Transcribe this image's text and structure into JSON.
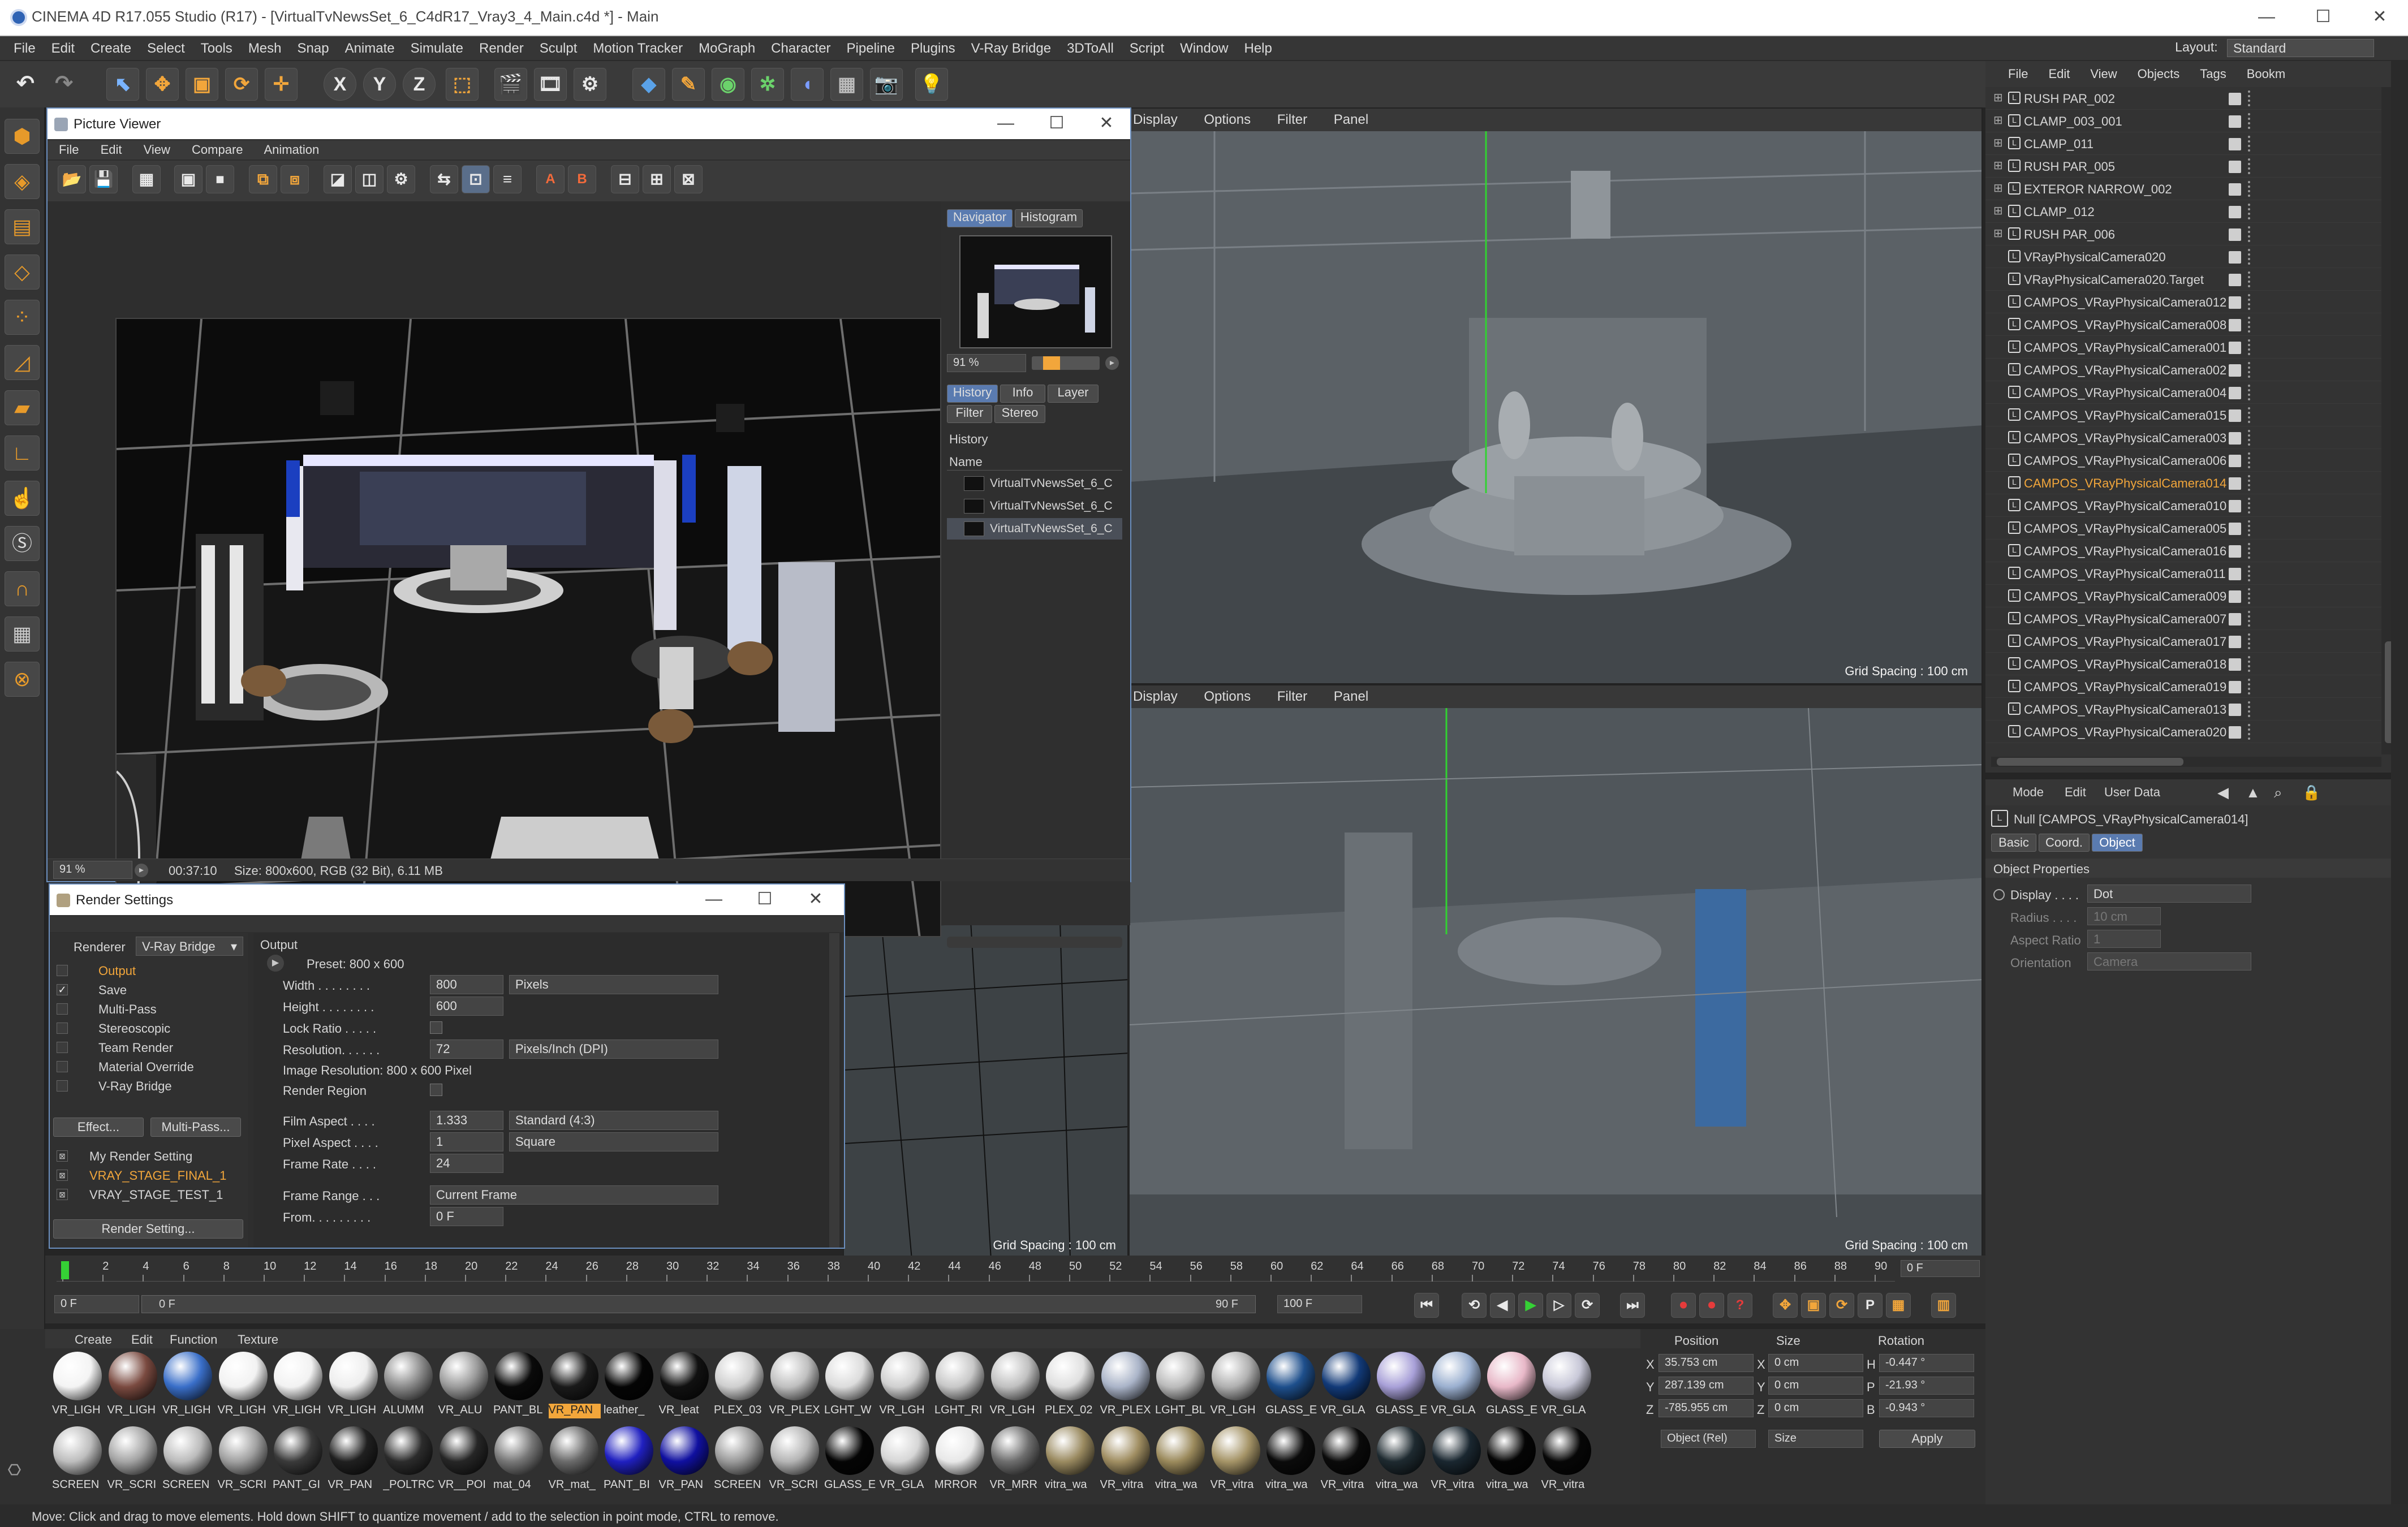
{
  "app": {
    "title": "CINEMA 4D R17.055 Studio (R17) - [VirtualTvNewsSet_6_C4dR17_Vray3_4_Main.c4d *] - Main",
    "window_controls": [
      "—",
      "☐",
      "✕"
    ]
  },
  "menubar": {
    "items": [
      "File",
      "Edit",
      "Create",
      "Select",
      "Tools",
      "Mesh",
      "Snap",
      "Animate",
      "Simulate",
      "Render",
      "Sculpt",
      "Motion Tracker",
      "MoGraph",
      "Character",
      "Pipeline",
      "Plugins",
      "V-Ray Bridge",
      "3DToAll",
      "Script",
      "Window",
      "Help"
    ],
    "layout_label": "Layout:",
    "layout_value": "Standard"
  },
  "toolbar": {
    "axis_x": "X",
    "axis_y": "Y",
    "axis_z": "Z"
  },
  "viewports": {
    "top_right": {
      "menu": [
        "Display",
        "Options",
        "Filter",
        "Panel"
      ],
      "grid": "Grid Spacing : 100 cm"
    },
    "bottom_right": {
      "menu": [
        "Display",
        "Options",
        "Filter",
        "Panel"
      ],
      "grid": "Grid Spacing : 100 cm"
    },
    "bottom_left": {
      "grid": "Grid Spacing : 100 cm"
    }
  },
  "picture_viewer": {
    "title": "Picture Viewer",
    "menu": [
      "File",
      "Edit",
      "View",
      "Compare",
      "Animation"
    ],
    "tabs": [
      "Navigator",
      "Histogram"
    ],
    "zoom": "91 %",
    "tabs2": [
      "History",
      "Info",
      "Layer",
      "Filter",
      "Stereo"
    ],
    "history_header": "History",
    "name_col": "Name",
    "history_items": [
      "VirtualTvNewsSet_6_C",
      "VirtualTvNewsSet_6_C",
      "VirtualTvNewsSet_6_C"
    ],
    "status_zoom": "91 %",
    "status_time": "00:37:10",
    "status_size": "Size: 800x600, RGB (32 Bit), 6.11 MB"
  },
  "render_settings": {
    "title": "Render Settings",
    "renderer_label": "Renderer",
    "renderer_value": "V-Ray Bridge",
    "nav": [
      {
        "label": "Output",
        "checked": false,
        "active": true
      },
      {
        "label": "Save",
        "checked": true,
        "active": false
      },
      {
        "label": "Multi-Pass",
        "checked": false,
        "active": false
      },
      {
        "label": "Stereoscopic",
        "checked": false,
        "active": false
      },
      {
        "label": "Team Render",
        "checked": false,
        "active": false
      },
      {
        "label": "Material Override",
        "checked": false,
        "active": false
      },
      {
        "label": "V-Ray Bridge",
        "checked": false,
        "active": false
      }
    ],
    "effect_btn": "Effect...",
    "multipass_btn": "Multi-Pass...",
    "presets": [
      "My Render Setting",
      "VRAY_STAGE_FINAL_1",
      "VRAY_STAGE_TEST_1"
    ],
    "render_setting_btn": "Render Setting...",
    "section": "Output",
    "preset": "Preset: 800 x 600",
    "width_label": "Width . . . . . . . .",
    "width": "800",
    "width_unit": "Pixels",
    "height_label": "Height . . . . . . . .",
    "height": "600",
    "lock_label": "Lock Ratio . . . . .",
    "resolution_label": "Resolution. . . . . .",
    "resolution": "72",
    "resolution_unit": "Pixels/Inch (DPI)",
    "image_res": "Image Resolution: 800 x 600 Pixel",
    "render_region_label": "Render Region",
    "film_label": "Film Aspect . . . .",
    "film": "1.333",
    "film_unit": "Standard (4:3)",
    "pixel_label": "Pixel Aspect . . . .",
    "pixel": "1",
    "pixel_unit": "Square",
    "frame_rate_label": "Frame Rate . . . .",
    "frame_rate": "24",
    "frame_range_label": "Frame Range . . .",
    "frame_range": "Current Frame",
    "from_label": "From. . . . . . . . .",
    "from": "0 F"
  },
  "object_manager": {
    "menu": [
      "File",
      "Edit",
      "View",
      "Objects",
      "Tags",
      "Bookm"
    ],
    "items": [
      {
        "name": "RUSH PAR_002",
        "expand": true
      },
      {
        "name": "CLAMP_003_001",
        "expand": true
      },
      {
        "name": "CLAMP_011",
        "expand": true
      },
      {
        "name": "RUSH PAR_005",
        "expand": true
      },
      {
        "name": "EXTEROR NARROW_002",
        "expand": true
      },
      {
        "name": "CLAMP_012",
        "expand": true
      },
      {
        "name": "RUSH PAR_006",
        "expand": true
      },
      {
        "name": "VRayPhysicalCamera020",
        "expand": false
      },
      {
        "name": "VRayPhysicalCamera020.Target",
        "expand": false
      },
      {
        "name": "CAMPOS_VRayPhysicalCamera012",
        "expand": false
      },
      {
        "name": "CAMPOS_VRayPhysicalCamera008",
        "expand": false
      },
      {
        "name": "CAMPOS_VRayPhysicalCamera001",
        "expand": false
      },
      {
        "name": "CAMPOS_VRayPhysicalCamera002",
        "expand": false
      },
      {
        "name": "CAMPOS_VRayPhysicalCamera004",
        "expand": false
      },
      {
        "name": "CAMPOS_VRayPhysicalCamera015",
        "expand": false
      },
      {
        "name": "CAMPOS_VRayPhysicalCamera003",
        "expand": false
      },
      {
        "name": "CAMPOS_VRayPhysicalCamera006",
        "expand": false
      },
      {
        "name": "CAMPOS_VRayPhysicalCamera014",
        "expand": false,
        "selected": true
      },
      {
        "name": "CAMPOS_VRayPhysicalCamera010",
        "expand": false
      },
      {
        "name": "CAMPOS_VRayPhysicalCamera005",
        "expand": false
      },
      {
        "name": "CAMPOS_VRayPhysicalCamera016",
        "expand": false
      },
      {
        "name": "CAMPOS_VRayPhysicalCamera011",
        "expand": false
      },
      {
        "name": "CAMPOS_VRayPhysicalCamera009",
        "expand": false
      },
      {
        "name": "CAMPOS_VRayPhysicalCamera007",
        "expand": false
      },
      {
        "name": "CAMPOS_VRayPhysicalCamera017",
        "expand": false
      },
      {
        "name": "CAMPOS_VRayPhysicalCamera018",
        "expand": false
      },
      {
        "name": "CAMPOS_VRayPhysicalCamera019",
        "expand": false
      },
      {
        "name": "CAMPOS_VRayPhysicalCamera013",
        "expand": false
      },
      {
        "name": "CAMPOS_VRayPhysicalCamera020",
        "expand": false
      }
    ]
  },
  "attributes": {
    "menu": [
      "Mode",
      "Edit",
      "User Data"
    ],
    "object_name": "Null [CAMPOS_VRayPhysicalCamera014]",
    "tabs": [
      "Basic",
      "Coord.",
      "Object"
    ],
    "section": "Object Properties",
    "display_label": "Display . . . .",
    "display": "Dot",
    "radius_label": "Radius . . . .",
    "radius": "10 cm",
    "aspect_label": "Aspect Ratio",
    "aspect": "1",
    "orientation_label": "Orientation",
    "orientation": "Camera"
  },
  "timeline": {
    "ticks": [
      "0",
      "2",
      "4",
      "6",
      "8",
      "10",
      "12",
      "14",
      "16",
      "18",
      "20",
      "22",
      "24",
      "26",
      "28",
      "30",
      "32",
      "34",
      "36",
      "38",
      "40",
      "42",
      "44",
      "46",
      "48",
      "50",
      "52",
      "54",
      "56",
      "58",
      "60",
      "62",
      "64",
      "66",
      "68",
      "70",
      "72",
      "74",
      "76",
      "78",
      "80",
      "82",
      "84",
      "86",
      "88",
      "90"
    ],
    "current": "0 F",
    "start": "0 F",
    "range_start": "0 F",
    "range_end": "90 F",
    "end": "100 F"
  },
  "materials": {
    "menu": [
      "Create",
      "Edit",
      "Function",
      "Texture"
    ],
    "row1": [
      {
        "label": "VR_LIGH",
        "color": "#f4f4f4"
      },
      {
        "label": "VR_LIGH",
        "color": "#7a4a40"
      },
      {
        "label": "VR_LIGH",
        "color": "#3a6fc9"
      },
      {
        "label": "VR_LIGH",
        "color": "#f2f2f2"
      },
      {
        "label": "VR_LIGH",
        "color": "#f2f2f2"
      },
      {
        "label": "VR_LIGH",
        "color": "#eeeeee"
      },
      {
        "label": "ALUMM",
        "color": "#8a8a8a"
      },
      {
        "label": "VR_ALU",
        "color": "#9a9a9a"
      },
      {
        "label": "PANT_BL",
        "color": "#0a0a0a"
      },
      {
        "label": "VR_PAN",
        "color": "#1a1a1a",
        "selected": true
      },
      {
        "label": "leather_",
        "color": "#050505"
      },
      {
        "label": "VR_leat",
        "color": "#111111"
      },
      {
        "label": "PLEX_03",
        "color": "#cfcfcf"
      },
      {
        "label": "VR_PLEX",
        "color": "#bfbfbf"
      },
      {
        "label": "LGHT_W",
        "color": "#dcdcdc"
      },
      {
        "label": "VR_LGH",
        "color": "#d0d0d0"
      },
      {
        "label": "LGHT_RI",
        "color": "#c8c8c8"
      },
      {
        "label": "VR_LGH",
        "color": "#c0c0c0"
      },
      {
        "label": "PLEX_02",
        "color": "#e0e0e0"
      },
      {
        "label": "VR_PLEX",
        "color": "#aab4c8"
      },
      {
        "label": "LGHT_BL",
        "color": "#bbbbbb"
      },
      {
        "label": "VR_LGH",
        "color": "#b0b0b0"
      },
      {
        "label": "GLASS_E",
        "color": "#1e4f8c"
      },
      {
        "label": "VR_GLA",
        "color": "#123a78"
      },
      {
        "label": "GLASS_E",
        "color": "#a8a0d8"
      },
      {
        "label": "VR_GLA",
        "color": "#9bb0d0"
      },
      {
        "label": "GLASS_E",
        "color": "#e8b8c8"
      },
      {
        "label": "VR_GLA",
        "color": "#c8c8d8"
      }
    ],
    "row2": [
      {
        "label": "SCREEN",
        "color": "#bdbdbd"
      },
      {
        "label": "VR_SCRI",
        "color": "#a5a5a5"
      },
      {
        "label": "SCREEN",
        "color": "#bbbbbb"
      },
      {
        "label": "VR_SCRI",
        "color": "#a0a0a0"
      },
      {
        "label": "PANT_GI",
        "color": "#3a3a3a"
      },
      {
        "label": "VR_PAN",
        "color": "#202020"
      },
      {
        "label": "_POLTRC",
        "color": "#2c2c2c"
      },
      {
        "label": "VR__POI",
        "color": "#262626"
      },
      {
        "label": "mat_04",
        "color": "#777777"
      },
      {
        "label": "VR_mat_",
        "color": "#6a6a6a"
      },
      {
        "label": "PANT_BI",
        "color": "#2020c0"
      },
      {
        "label": "VR_PAN",
        "color": "#1010a0"
      },
      {
        "label": "SCREEN",
        "color": "#9a9a9a"
      },
      {
        "label": "VR_SCRI",
        "color": "#b5b5b5"
      },
      {
        "label": "GLASS_E",
        "color": "#050505"
      },
      {
        "label": "VR_GLA",
        "color": "#d6d6d6"
      },
      {
        "label": "MRROR",
        "color": "#e8e8e8"
      },
      {
        "label": "VR_MRR",
        "color": "#6e6e6e"
      },
      {
        "label": "vitra_wa",
        "color": "#9a8a60"
      },
      {
        "label": "VR_vitra",
        "color": "#a08e62"
      },
      {
        "label": "vitra_wa",
        "color": "#9b8a5c"
      },
      {
        "label": "VR_vitra",
        "color": "#a59467"
      },
      {
        "label": "vitra_wa",
        "color": "#0b0b0b"
      },
      {
        "label": "VR_vitra",
        "color": "#0a0a0a"
      },
      {
        "label": "vitra_wa",
        "color": "#1e2a30"
      },
      {
        "label": "VR_vitra",
        "color": "#1a2730"
      },
      {
        "label": "vitra_wa",
        "color": "#050505"
      },
      {
        "label": "VR_vitra",
        "color": "#070707"
      }
    ]
  },
  "coordinates": {
    "headers": [
      "Position",
      "Size",
      "Rotation"
    ],
    "rows": [
      {
        "axis": "X",
        "pos": "35.753 cm",
        "saxis": "X",
        "size": "0 cm",
        "raxis": "H",
        "rot": "-0.447 °"
      },
      {
        "axis": "Y",
        "pos": "287.139 cm",
        "saxis": "Y",
        "size": "0 cm",
        "raxis": "P",
        "rot": "-21.93 °"
      },
      {
        "axis": "Z",
        "pos": "-785.955 cm",
        "saxis": "Z",
        "size": "0 cm",
        "raxis": "B",
        "rot": "-0.943 °"
      }
    ],
    "mode": "Object (Rel)",
    "size_mode": "Size",
    "apply": "Apply"
  },
  "status": "Move: Click and drag to move elements. Hold down SHIFT to quantize movement / add to the selection in point mode, CTRL to remove."
}
